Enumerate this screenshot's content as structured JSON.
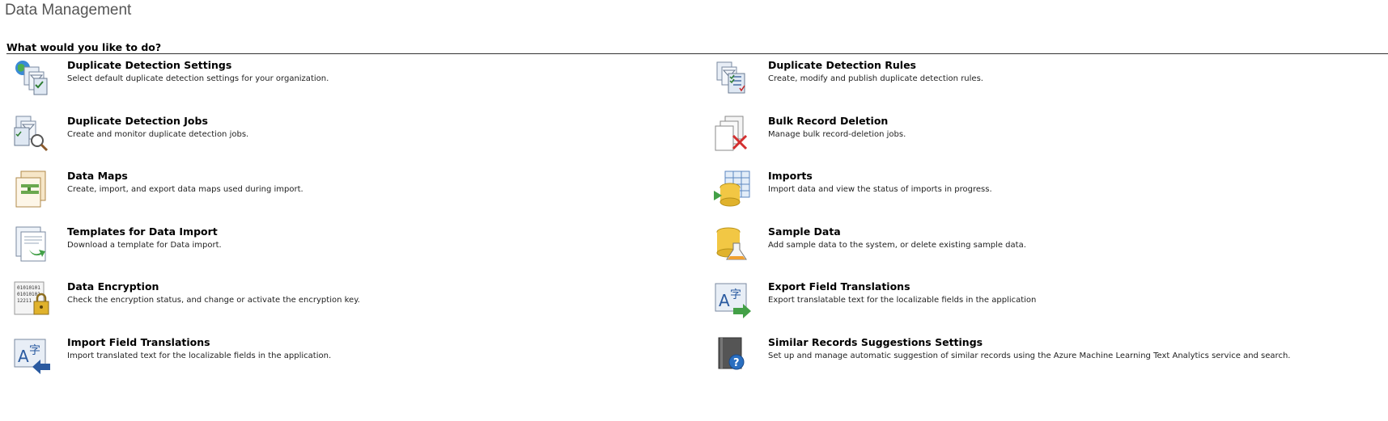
{
  "page": {
    "title": "Data Management",
    "section_header": "What would you like to do?"
  },
  "items": [
    {
      "title": "Duplicate Detection Settings",
      "description": "Select default duplicate detection settings for your organization.",
      "icon": "duplicate-detection-settings-icon"
    },
    {
      "title": "Duplicate Detection Rules",
      "description": "Create, modify and publish duplicate detection rules.",
      "icon": "duplicate-detection-rules-icon"
    },
    {
      "title": "Duplicate Detection Jobs",
      "description": "Create and monitor duplicate detection jobs.",
      "icon": "duplicate-detection-jobs-icon"
    },
    {
      "title": "Bulk Record Deletion",
      "description": "Manage bulk record-deletion jobs.",
      "icon": "bulk-record-deletion-icon"
    },
    {
      "title": "Data Maps",
      "description": "Create, import, and export data maps used during import.",
      "icon": "data-maps-icon"
    },
    {
      "title": "Imports",
      "description": "Import data and view the status of imports in progress.",
      "icon": "imports-icon"
    },
    {
      "title": "Templates for Data Import",
      "description": "Download a template for Data import.",
      "icon": "templates-icon"
    },
    {
      "title": "Sample Data",
      "description": "Add sample data to the system, or delete existing sample data.",
      "icon": "sample-data-icon"
    },
    {
      "title": "Data Encryption",
      "description": "Check the encryption status, and change or activate the encryption key.",
      "icon": "data-encryption-icon"
    },
    {
      "title": "Export Field Translations",
      "description": "Export translatable text for the localizable fields in the application",
      "icon": "export-translations-icon"
    },
    {
      "title": "Import Field Translations",
      "description": "Import translated text for the localizable fields in the application.",
      "icon": "import-translations-icon"
    },
    {
      "title": "Similar Records Suggestions Settings",
      "description": "Set up and manage automatic suggestion of similar records using the Azure Machine Learning Text Analytics service and search.",
      "icon": "similar-records-icon"
    }
  ]
}
